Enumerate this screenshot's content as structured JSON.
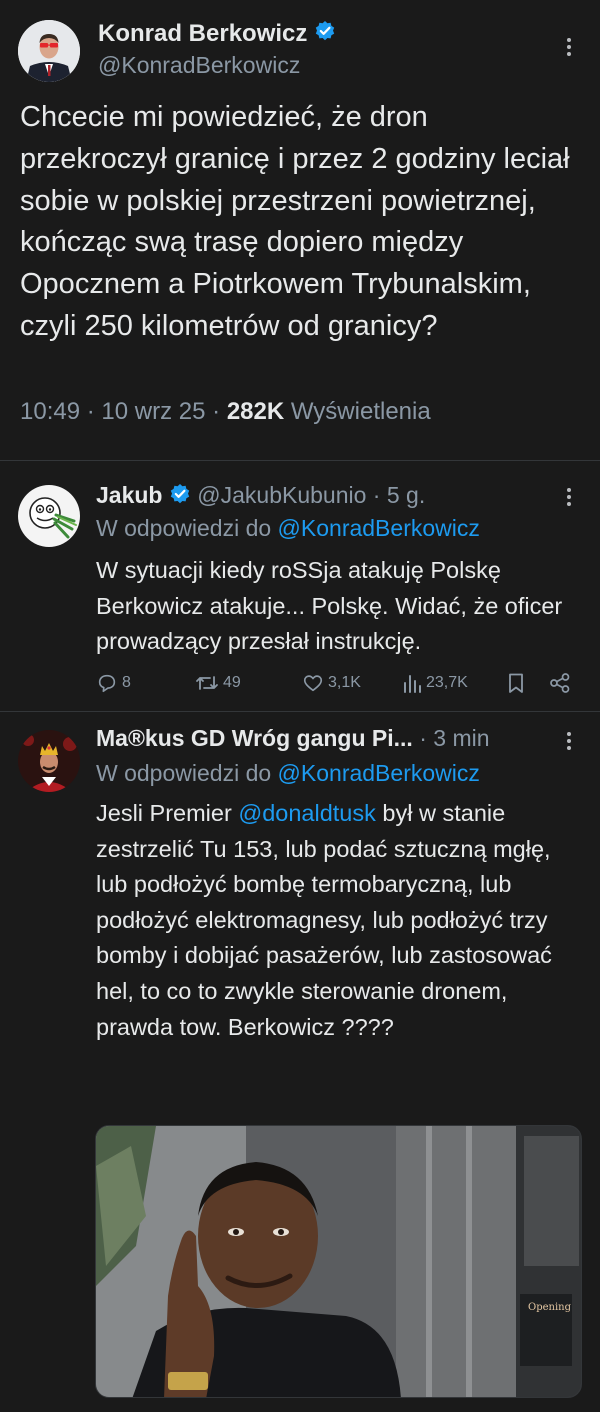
{
  "main_tweet": {
    "author_name": "Konrad Berkowicz",
    "author_handle": "@KonradBerkowicz",
    "text": "Chcecie mi powiedzieć, że dron przekroczył granicę i przez 2 godziny leciał sobie w polskiej przestrzeni powietrznej, kończąc swą trasę dopiero między Opocznem a Piotrkowem Trybunalskim, czyli 250 kilometrów od granicy?",
    "time": "10:49",
    "date": "10 wrz 25",
    "views": "282K",
    "views_label": "Wyświetlenia",
    "verified_icon": "verified-badge-icon",
    "more_icon": "more-vertical-icon"
  },
  "replies": [
    {
      "author_name": "Jakub",
      "author_handle": "@JakubKubunio",
      "time_ago": "5 g.",
      "replying_prefix": "W odpowiedzi do",
      "replying_to": "@KonradBerkowicz",
      "text": "W sytuacji kiedy roSSja atakuję Polskę Berkowicz atakuje... Polskę. Widać, że oficer prowadzący przesłał instrukcję.",
      "actions": {
        "replies": "8",
        "reposts": "49",
        "likes": "3,1K",
        "views": "23,7K"
      }
    },
    {
      "author_name": "Ma®kus GD Wróg gangu Pi...",
      "time_ago": "3 min",
      "replying_prefix": "W odpowiedzi do",
      "replying_to": "@KonradBerkowicz",
      "text_before_mention": "Jesli Premier ",
      "mention": "@donaldtusk",
      "text_after_mention": " był w stanie zestrzelić Tu 153, lub podać sztuczną mgłę, lub podłożyć bombę termobaryczną, lub podłożyć elektromagnesy, lub podłożyć trzy bomby i dobijać pasażerów, lub zastosować hel, to co to zwykle sterowanie dronem, prawda tow. Berkowicz ????"
    }
  ],
  "colors": {
    "background": "#1a1a1a",
    "text": "#e7e9ea",
    "secondary_text": "#8b98a5",
    "link": "#1d9bf0",
    "verified": "#1d9bf0",
    "divider": "#333639"
  },
  "icons": [
    "reply-icon",
    "repost-icon",
    "like-icon",
    "views-icon",
    "bookmark-icon",
    "share-icon"
  ]
}
